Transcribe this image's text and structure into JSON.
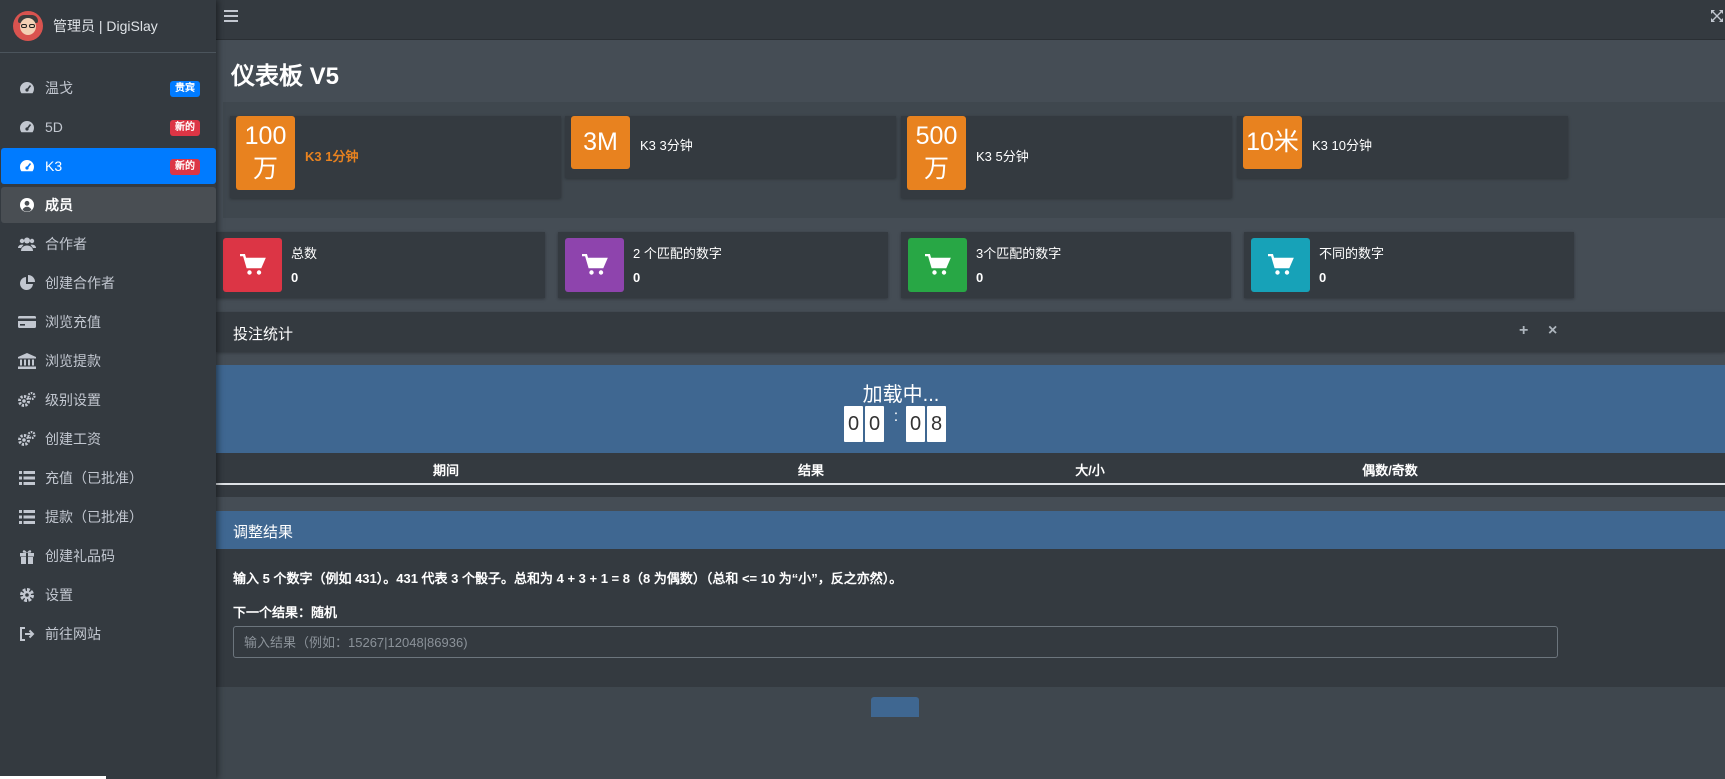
{
  "brand": {
    "title": "管理员 | DigiSlay"
  },
  "sidebar": {
    "items": [
      {
        "label": "温戈",
        "icon": "tachometer-icon",
        "badge": "贵宾",
        "badge_color": "#007bff"
      },
      {
        "label": "5D",
        "icon": "tachometer-icon",
        "badge": "新的",
        "badge_color": "#dc3545"
      },
      {
        "label": "K3",
        "icon": "tachometer-icon",
        "badge": "新的",
        "badge_color": "#dc3545",
        "active": true
      },
      {
        "label": "成员",
        "icon": "user-circle-icon",
        "hover": true
      },
      {
        "label": "合作者",
        "icon": "users-icon"
      },
      {
        "label": "创建合作者",
        "icon": "pie-chart-icon"
      },
      {
        "label": "浏览充值",
        "icon": "credit-card-icon"
      },
      {
        "label": "浏览提款",
        "icon": "bank-icon"
      },
      {
        "label": "级别设置",
        "icon": "cogs-icon"
      },
      {
        "label": "创建工资",
        "icon": "cogs-icon"
      },
      {
        "label": "充值（已批准）",
        "icon": "list-icon"
      },
      {
        "label": "提款（已批准）",
        "icon": "list-icon"
      },
      {
        "label": "创建礼品码",
        "icon": "gift-icon"
      },
      {
        "label": "设置",
        "icon": "gear-icon"
      },
      {
        "label": "前往网站",
        "icon": "sign-out-icon"
      }
    ]
  },
  "page": {
    "title": "仪表板 V5"
  },
  "games": [
    {
      "icon_text": "100万",
      "label": "K3 1分钟",
      "highlight": true
    },
    {
      "icon_text": "3M",
      "label": "K3 3分钟"
    },
    {
      "icon_text": "500万",
      "label": "K3 5分钟"
    },
    {
      "icon_text": "10米",
      "label": "K3 10分钟"
    }
  ],
  "stats": [
    {
      "label": "总数",
      "value": "0",
      "color": "#dc3545",
      "icon": "cart-icon"
    },
    {
      "label": "2 个匹配的数字",
      "value": "0",
      "color": "#8e44ad",
      "icon": "cart-icon"
    },
    {
      "label": "3个匹配的数字",
      "value": "0",
      "color": "#28a745",
      "icon": "cart-icon"
    },
    {
      "label": "不同的数字",
      "value": "0",
      "color": "#17a2b8",
      "icon": "cart-icon"
    }
  ],
  "bet_stats": {
    "title": "投注统计",
    "add": "+",
    "close": "×"
  },
  "loading": {
    "text": "加载中...",
    "digits": [
      "0",
      "0",
      "0",
      "8"
    ],
    "colon": ":"
  },
  "table": {
    "headers": [
      "期间",
      "结果",
      "大/小",
      "偶数/奇数"
    ]
  },
  "adjust": {
    "title": "调整结果",
    "description": "输入 5 个数字（例如 431）。431 代表 3 个骰子。总和为 4 + 3 + 1 = 8（8 为偶数）（总和 <= 10 为“小”，反之亦然）。",
    "next_result": "下一个结果：随机",
    "placeholder": "输入结果（例如：15267|12048|86936)"
  }
}
